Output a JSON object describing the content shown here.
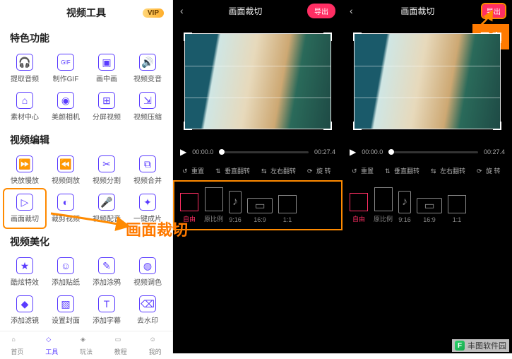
{
  "sidebar": {
    "title": "视频工具",
    "vip": "VIP",
    "sections": [
      {
        "title": "特色功能",
        "tools": [
          {
            "label": "提取音频",
            "icon": "headphones-icon"
          },
          {
            "label": "制作GIF",
            "icon": "gif-icon"
          },
          {
            "label": "画中画",
            "icon": "pip-icon"
          },
          {
            "label": "视频变音",
            "icon": "voice-icon"
          },
          {
            "label": "素材中心",
            "icon": "store-icon"
          },
          {
            "label": "美颜相机",
            "icon": "camera-icon"
          },
          {
            "label": "分屏视频",
            "icon": "split-icon"
          },
          {
            "label": "视频压缩",
            "icon": "compress-icon"
          }
        ]
      },
      {
        "title": "视频编辑",
        "tools": [
          {
            "label": "快放慢放",
            "icon": "speed-icon"
          },
          {
            "label": "视频倒放",
            "icon": "reverse-icon"
          },
          {
            "label": "视频分割",
            "icon": "cut-icon"
          },
          {
            "label": "视频合并",
            "icon": "merge-icon"
          },
          {
            "label": "画面裁切",
            "icon": "crop-icon",
            "highlight": true
          },
          {
            "label": "裁剪视频",
            "icon": "trim-icon"
          },
          {
            "label": "视频配音",
            "icon": "dub-icon"
          },
          {
            "label": "一键成片",
            "icon": "magic-icon"
          }
        ]
      },
      {
        "title": "视频美化",
        "tools": [
          {
            "label": "酷炫特效",
            "icon": "star-icon"
          },
          {
            "label": "添加贴纸",
            "icon": "sticker-icon"
          },
          {
            "label": "添加涂鸦",
            "icon": "brush-icon"
          },
          {
            "label": "视频调色",
            "icon": "palette-icon"
          },
          {
            "label": "添加滤镜",
            "icon": "filter-icon"
          },
          {
            "label": "设置封面",
            "icon": "cover-icon"
          },
          {
            "label": "添加字幕",
            "icon": "text-icon"
          },
          {
            "label": "去水印",
            "icon": "erase-icon"
          }
        ]
      }
    ],
    "bottom_nav": [
      {
        "label": "首页",
        "icon": "home-icon"
      },
      {
        "label": "工具",
        "icon": "tools-icon",
        "active": true
      },
      {
        "label": "玩法",
        "icon": "play-icon"
      },
      {
        "label": "教程",
        "icon": "book-icon"
      },
      {
        "label": "我的",
        "icon": "user-icon"
      }
    ]
  },
  "callouts": {
    "crop": "画面裁切",
    "export": "导出"
  },
  "editor": {
    "title": "画面裁切",
    "export": "导出",
    "time_start": "00:00.0",
    "time_end": "00:27.4",
    "transforms": {
      "reset": "重置",
      "flip_v": "垂直翻转",
      "flip_h": "左右翻转",
      "rotate": "旋   转"
    },
    "ratios": [
      {
        "label": "自由",
        "shape": "sh-free",
        "active": true
      },
      {
        "label": "原比例",
        "shape": "sh-orig"
      },
      {
        "label": "9:16",
        "shape": "sh-916"
      },
      {
        "label": "16:9",
        "shape": "sh-169"
      },
      {
        "label": "1:1",
        "shape": "sh-11"
      }
    ]
  },
  "watermark": {
    "text": "丰图软件园",
    "logo": "F"
  }
}
